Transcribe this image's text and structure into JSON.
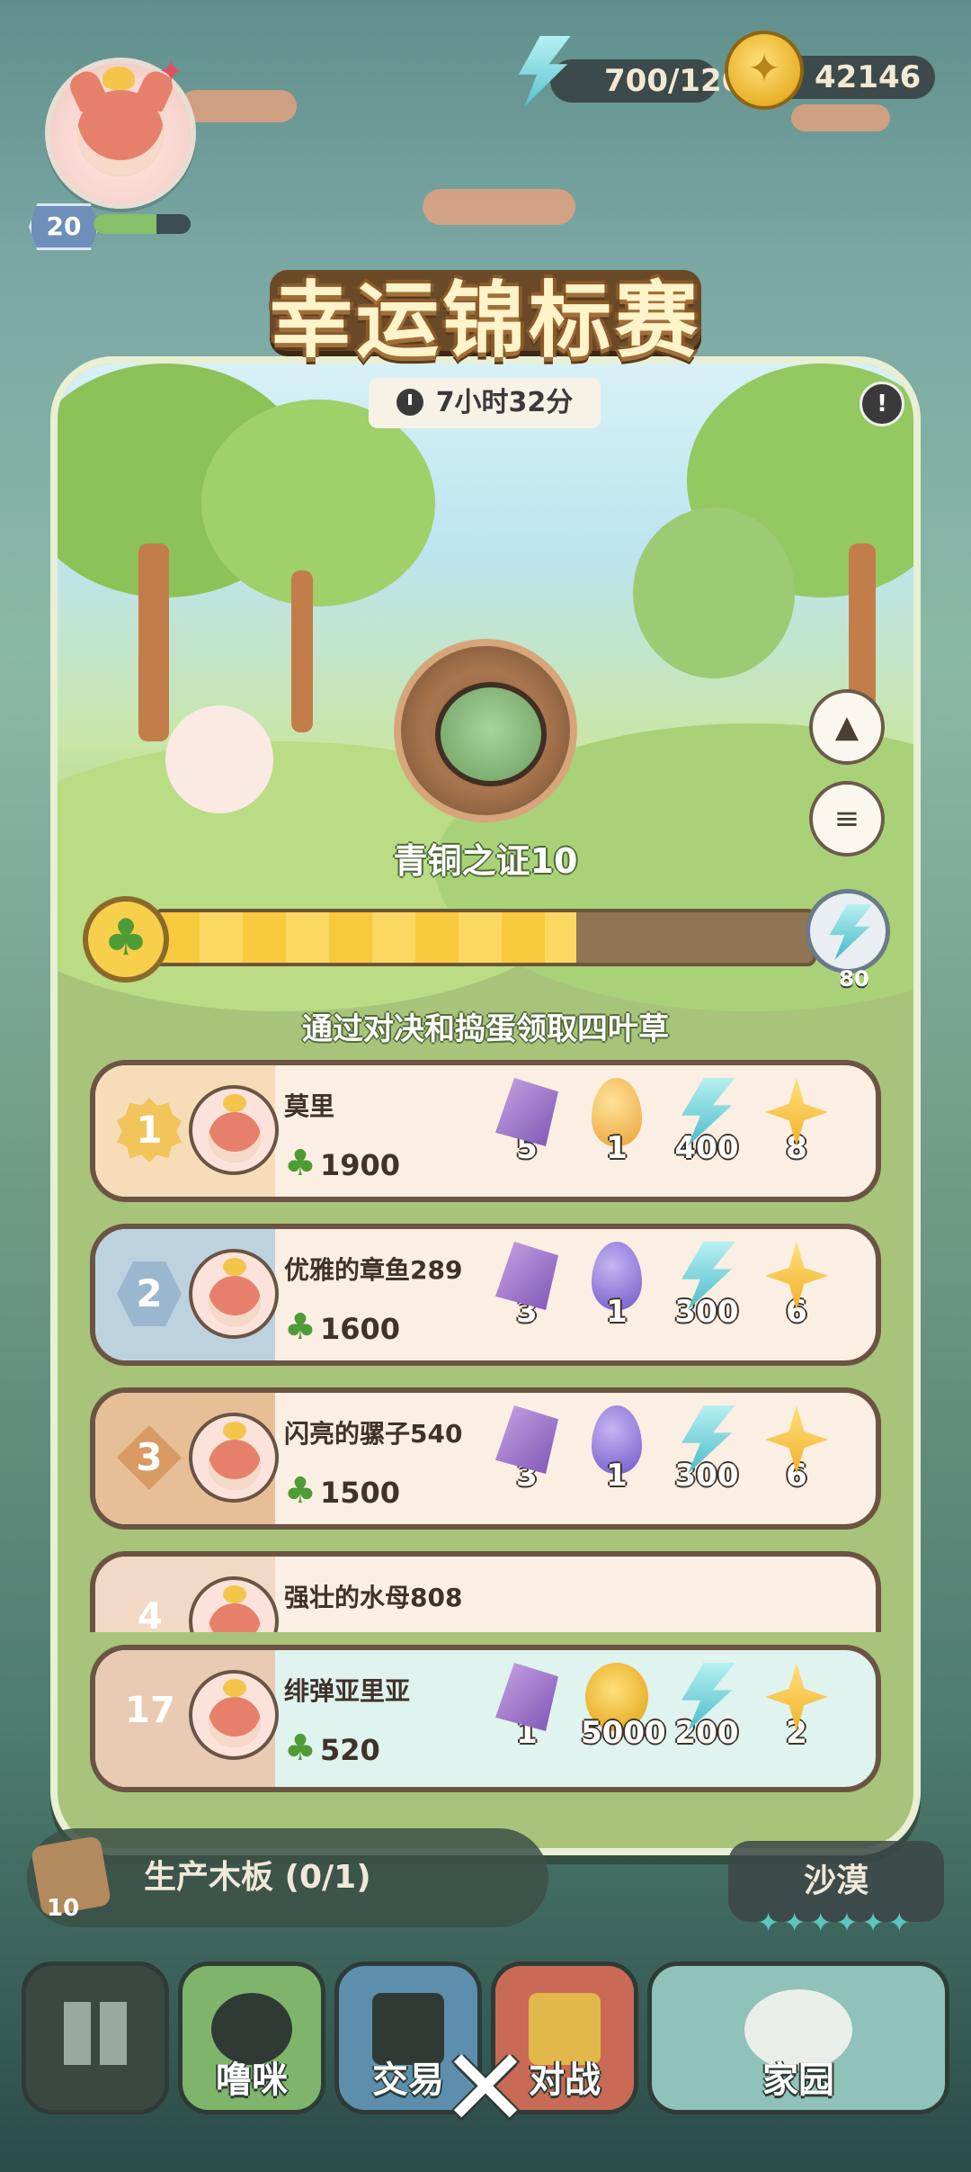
{
  "hud": {
    "level": "20",
    "level_progress": 0.65,
    "energy": "700/120",
    "coins": "42146"
  },
  "event": {
    "title": "幸运锦标赛",
    "timer": "7小时32分",
    "badge_name": "青铜之证10",
    "progress_fraction": 0.64,
    "progress_reward": "80",
    "instruction": "通过对决和捣蛋领取四叶草"
  },
  "leaderboard": [
    {
      "rank": "1",
      "name": "莫里",
      "score": "1900",
      "rewards": [
        {
          "icon": "shard-icon",
          "value": "5"
        },
        {
          "icon": "gold-egg-icon",
          "value": "1"
        },
        {
          "icon": "energy-icon",
          "value": "400"
        },
        {
          "icon": "star-icon",
          "value": "8"
        }
      ]
    },
    {
      "rank": "2",
      "name": "优雅的章鱼289",
      "score": "1600",
      "rewards": [
        {
          "icon": "shard-icon",
          "value": "3"
        },
        {
          "icon": "purple-egg-icon",
          "value": "1"
        },
        {
          "icon": "energy-icon",
          "value": "300"
        },
        {
          "icon": "star-icon",
          "value": "6"
        }
      ]
    },
    {
      "rank": "3",
      "name": "闪亮的骡子540",
      "score": "1500",
      "rewards": [
        {
          "icon": "shard-icon",
          "value": "3"
        },
        {
          "icon": "purple-egg-icon",
          "value": "1"
        },
        {
          "icon": "energy-icon",
          "value": "300"
        },
        {
          "icon": "star-icon",
          "value": "6"
        }
      ]
    },
    {
      "rank": "4",
      "name": "强壮的水母808",
      "score": "",
      "rewards": []
    }
  ],
  "my_rank": {
    "rank": "17",
    "name": "绯弹亚里亚",
    "score": "520",
    "rewards": [
      {
        "icon": "shard-icon",
        "value": "1"
      },
      {
        "icon": "coin-icon",
        "value": "5000"
      },
      {
        "icon": "energy-icon",
        "value": "200"
      },
      {
        "icon": "star-icon",
        "value": "2"
      }
    ]
  },
  "bottom": {
    "task_label": "生产木板 (0/1)",
    "task_count": "10",
    "desert_label": "沙漠",
    "nav": {
      "pets": "噜咪",
      "trade": "交易",
      "battle": "对战",
      "home": "家园"
    }
  },
  "colors": {
    "panel": "#a8c47a",
    "progress_fill": "#f8c93c",
    "row_bg": "#fbeee2",
    "my_row_bg": "#dff3ef"
  }
}
